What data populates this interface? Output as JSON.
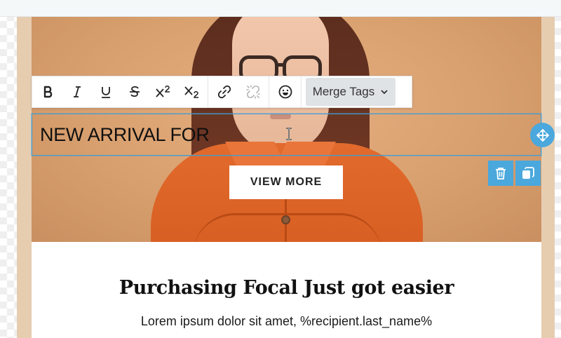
{
  "toolbar": {
    "buttons": [
      {
        "name": "bold",
        "icon": "bold-icon"
      },
      {
        "name": "italic",
        "icon": "italic-icon"
      },
      {
        "name": "underline",
        "icon": "underline-icon"
      },
      {
        "name": "strikethrough",
        "icon": "strikethrough-icon"
      },
      {
        "name": "superscript",
        "icon": "superscript-icon"
      },
      {
        "name": "subscript",
        "icon": "subscript-icon"
      },
      {
        "name": "link",
        "icon": "link-icon"
      },
      {
        "name": "unlink",
        "icon": "unlink-icon",
        "disabled": true
      },
      {
        "name": "emoji",
        "icon": "emoji-icon"
      }
    ],
    "merge_tags_label": "Merge Tags"
  },
  "hero": {
    "editing_text": "NEW ARRIVAL FOR",
    "button_label": "VIEW MORE"
  },
  "block_actions": {
    "move_icon": "move-icon",
    "delete_icon": "trash-icon",
    "duplicate_icon": "duplicate-icon"
  },
  "content": {
    "headline": "Purchasing Focal Just got easier",
    "body": "Lorem ipsum dolor sit amet, %recipient.last_name%"
  },
  "colors": {
    "accent": "#4aa8dd",
    "frame": "#e6cdb0",
    "shirt": "#d45b1f"
  }
}
